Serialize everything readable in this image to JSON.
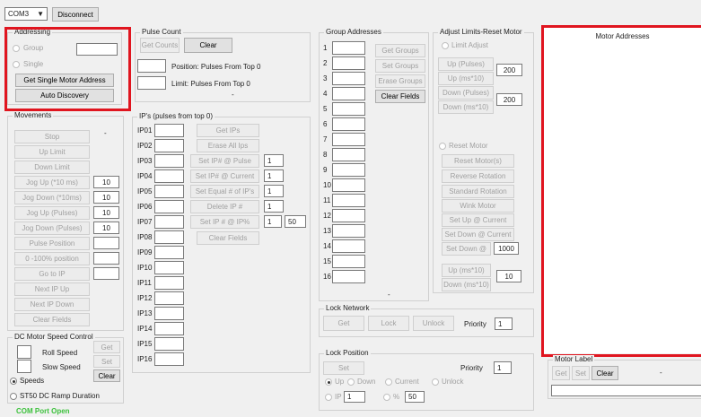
{
  "connection": {
    "port": "COM3",
    "disconnect": "Disconnect",
    "status": "COM Port Open",
    "status_color": "#3cc13c"
  },
  "addressing": {
    "title": "Addressing",
    "group": "Group",
    "single": "Single",
    "get_single": "Get Single Motor Address",
    "auto_discovery": "Auto Discovery"
  },
  "pulse_count": {
    "title": "Pulse Count",
    "get_counts": "Get Counts",
    "clear": "Clear",
    "position_label": "Position: Pulses From Top 0",
    "limit_label": "Limit: Pulses From Top 0",
    "dash": "-"
  },
  "movements": {
    "title": "Movements",
    "dash": "-",
    "stop": "Stop",
    "up_limit": "Up Limit",
    "down_limit": "Down Limit",
    "jog_up_10ms": "Jog Up (*10 ms)",
    "jog_up_10ms_val": "10",
    "jog_down_10ms": "Jog Down (*10ms)",
    "jog_down_10ms_val": "10",
    "jog_up_pulses": "Jog Up (Pulses)",
    "jog_up_pulses_val": "10",
    "jog_down_pulses": "Jog Down (Pulses)",
    "jog_down_pulses_val": "10",
    "pulse_position": "Pulse Position",
    "pct_position": "0 -100% position",
    "goto_ip": "Go to IP",
    "next_ip_up": "Next IP Up",
    "next_ip_down": "Next IP Down",
    "clear_fields": "Clear Fields"
  },
  "ips": {
    "title": "IP's (pulses from top 0)",
    "labels": [
      "IP01",
      "IP02",
      "IP03",
      "IP04",
      "IP05",
      "IP06",
      "IP07",
      "IP08",
      "IP09",
      "IP10",
      "IP11",
      "IP12",
      "IP13",
      "IP14",
      "IP15",
      "IP16"
    ],
    "get_ips": "Get IPs",
    "erase_all": "Erase All Ips",
    "set_pulse": "Set IP# @ Pulse",
    "set_pulse_val": "1",
    "set_current": "Set IP# @ Current",
    "set_current_val": "1",
    "set_equal": "Set Equal # of IP's",
    "set_equal_val": "1",
    "delete": "Delete IP #",
    "delete_val": "1",
    "set_pct": "Set IP # @ IP%",
    "set_pct_val1": "1",
    "set_pct_val2": "50",
    "clear_fields": "Clear Fields"
  },
  "dc_speed": {
    "title": "DC Motor Speed Control",
    "roll": "Roll Speed",
    "slow": "Slow Speed",
    "get": "Get",
    "set": "Set",
    "clear": "Clear",
    "speeds": "Speeds",
    "ramp": "ST50 DC Ramp Duration"
  },
  "group_addresses": {
    "title": "Group Addresses",
    "numbers": [
      "1",
      "2",
      "3",
      "4",
      "5",
      "6",
      "7",
      "8",
      "9",
      "10",
      "11",
      "12",
      "13",
      "14",
      "15",
      "16"
    ],
    "get_groups": "Get Groups",
    "set_groups": "Set Groups",
    "erase_groups": "Erase Groups",
    "clear_fields": "Clear Fields",
    "dash": "-"
  },
  "limits": {
    "title": "Adjust Limits-Reset Motor",
    "limit_adjust": "Limit Adjust",
    "up_pulses": "Up (Pulses)",
    "up_ms": "Up (ms*10)",
    "down_pulses": "Down (Pulses)",
    "down_ms": "Down (ms*10)",
    "val_up": "200",
    "val_down": "200",
    "reset_motor_radio": "Reset Motor",
    "reset_motors": "Reset Motor(s)",
    "reverse": "Reverse Rotation",
    "standard": "Standard Rotation",
    "wink": "Wink Motor",
    "set_up_current": "Set Up @ Current",
    "set_down_current": "Set Down @ Current",
    "set_down_at": "Set Down @",
    "set_down_val": "1000",
    "up_ms2": "Up (ms*10)",
    "down_ms2": "Down (ms*10)",
    "val_ms": "10"
  },
  "lock_network": {
    "title": "Lock Network",
    "get": "Get",
    "lock": "Lock",
    "unlock": "Unlock",
    "priority": "Priority",
    "priority_val": "1"
  },
  "lock_position": {
    "title": "Lock Position",
    "set": "Set",
    "priority": "Priority",
    "priority_val": "1",
    "up": "Up",
    "down": "Down",
    "current": "Current",
    "unlock": "Unlock",
    "ip": "IP",
    "ip_val": "1",
    "pct": "%",
    "pct_val": "50"
  },
  "motor_addresses": {
    "title": "Motor Addresses"
  },
  "motor_label": {
    "title": "Motor Label",
    "get": "Get",
    "set": "Set",
    "clear": "Clear",
    "dash": "-"
  },
  "colors": {
    "highlight": "#e0151f"
  }
}
